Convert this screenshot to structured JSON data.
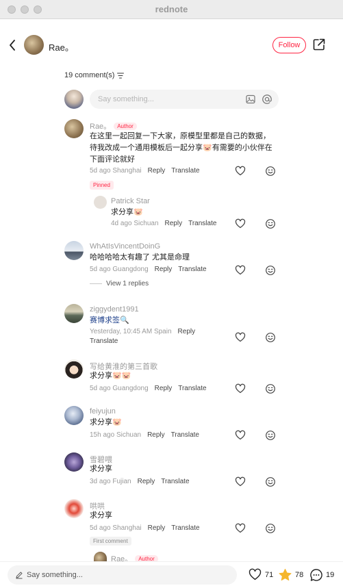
{
  "window": {
    "title": "rednote"
  },
  "header": {
    "author_name": "Rae。",
    "follow_label": "Follow"
  },
  "comments_header": {
    "count_label": "19 comment(s)"
  },
  "composer": {
    "placeholder": "Say something..."
  },
  "comments": [
    {
      "name": "Rae。",
      "badge": "Author",
      "text": "在这里一起回复一下大家，原模型里都是自己的数据，待我改成一个通用模板后一起分享🐷有需要的小伙伴在下面评论就好",
      "time": "5d ago",
      "location": "Shanghai",
      "reply_label": "Reply",
      "translate_label": "Translate",
      "pill": "Pinned"
    },
    {
      "name": "Patrick Star",
      "text": "求分享🐷",
      "time": "4d ago",
      "location": "Sichuan",
      "reply_label": "Reply",
      "translate_label": "Translate"
    },
    {
      "name": "WhAtIsVincentDoinG",
      "text": "哈哈哈哈太有趣了 尤其是命理",
      "time": "5d ago",
      "location": "Guangdong",
      "reply_label": "Reply",
      "translate_label": "Translate",
      "view_replies": "View 1 replies"
    },
    {
      "name": "ziggydent1991",
      "text": "赛博求签🔍",
      "time": "Yesterday, 10:45 AM",
      "location": "Spain",
      "reply_label": "Reply",
      "translate_label": "Translate"
    },
    {
      "name": "写给黄淮的第三首歌",
      "text": "求分享🐷🐷",
      "time": "5d ago",
      "location": "Guangdong",
      "reply_label": "Reply",
      "translate_label": "Translate"
    },
    {
      "name": "feiyujun",
      "text": "求分享🐷",
      "time": "15h ago",
      "location": "Sichuan",
      "reply_label": "Reply",
      "translate_label": "Translate"
    },
    {
      "name": "雪碧喂",
      "text": "求分享",
      "time": "3d ago",
      "location": "Fujian",
      "reply_label": "Reply",
      "translate_label": "Translate"
    },
    {
      "name": "哄哄",
      "text": "求分享",
      "time": "5d ago",
      "location": "Shanghai",
      "reply_label": "Reply",
      "translate_label": "Translate",
      "pill": "First comment"
    },
    {
      "name": "Rae。",
      "badge": "Author"
    }
  ],
  "bottom_bar": {
    "placeholder": "Say something...",
    "likes": "71",
    "collects": "78",
    "comments": "19"
  },
  "colors": {
    "accent": "#ff2442",
    "star": "#f5b62b"
  },
  "icons": [
    "back-arrow-icon",
    "share-icon",
    "image-icon",
    "at-icon",
    "heart-icon",
    "smile-icon",
    "pencil-icon",
    "star-icon",
    "comment-bubble-icon",
    "sort-icon"
  ]
}
